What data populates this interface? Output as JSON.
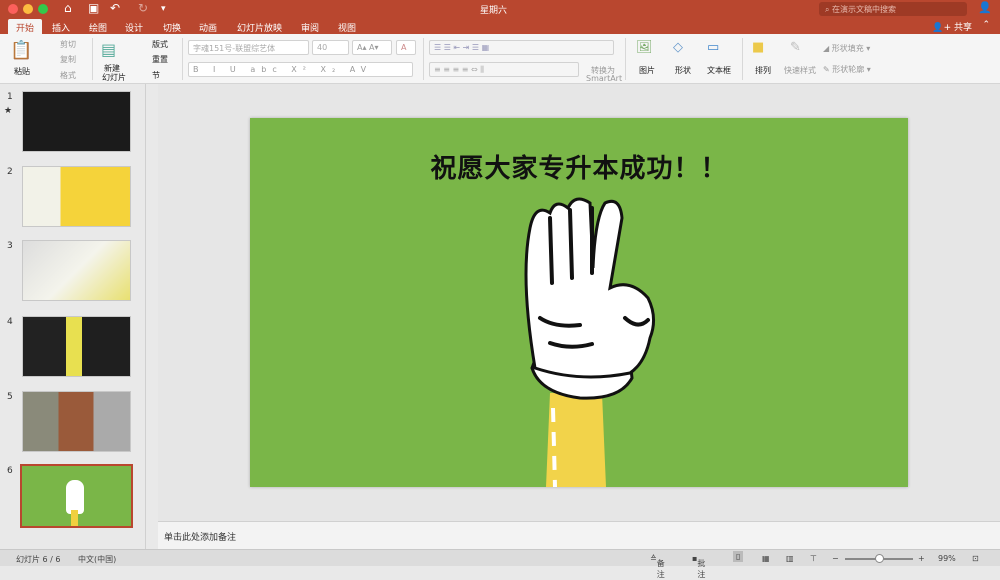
{
  "window": {
    "title": "星期六",
    "search_placeholder": "在演示文稿中搜索",
    "share": "共享"
  },
  "tabs": [
    "开始",
    "插入",
    "绘图",
    "设计",
    "切换",
    "动画",
    "幻灯片放映",
    "审阅",
    "视图"
  ],
  "ribbon": {
    "paste": "粘贴",
    "cut": "剪切",
    "copy": "复制",
    "format": "格式",
    "new_slide_l1": "新建",
    "new_slide_l2": "幻灯片",
    "layout": "版式",
    "reset": "重置",
    "section": "节",
    "font_name": "字魂151号-联盟综艺体",
    "font_size": "40",
    "convert_l1": "转换为",
    "convert_l2": "SmartArt",
    "picture": "图片",
    "shape": "形状",
    "textbox": "文本框",
    "arrange": "排列",
    "quick_styles": "快速样式",
    "shape_fill": "形状填充",
    "shape_outline": "形状轮廓"
  },
  "slides": [
    {
      "n": "1"
    },
    {
      "n": "2"
    },
    {
      "n": "3"
    },
    {
      "n": "4"
    },
    {
      "n": "5"
    },
    {
      "n": "6"
    }
  ],
  "slide": {
    "title": "祝愿大家专升本成功！！",
    "bg": "#7ab648"
  },
  "notes_placeholder": "单击此处添加备注",
  "status": {
    "slide_count": "幻灯片 6 / 6",
    "language": "中文(中国)",
    "notes": "备注",
    "comments": "批注",
    "zoom": "99%"
  }
}
